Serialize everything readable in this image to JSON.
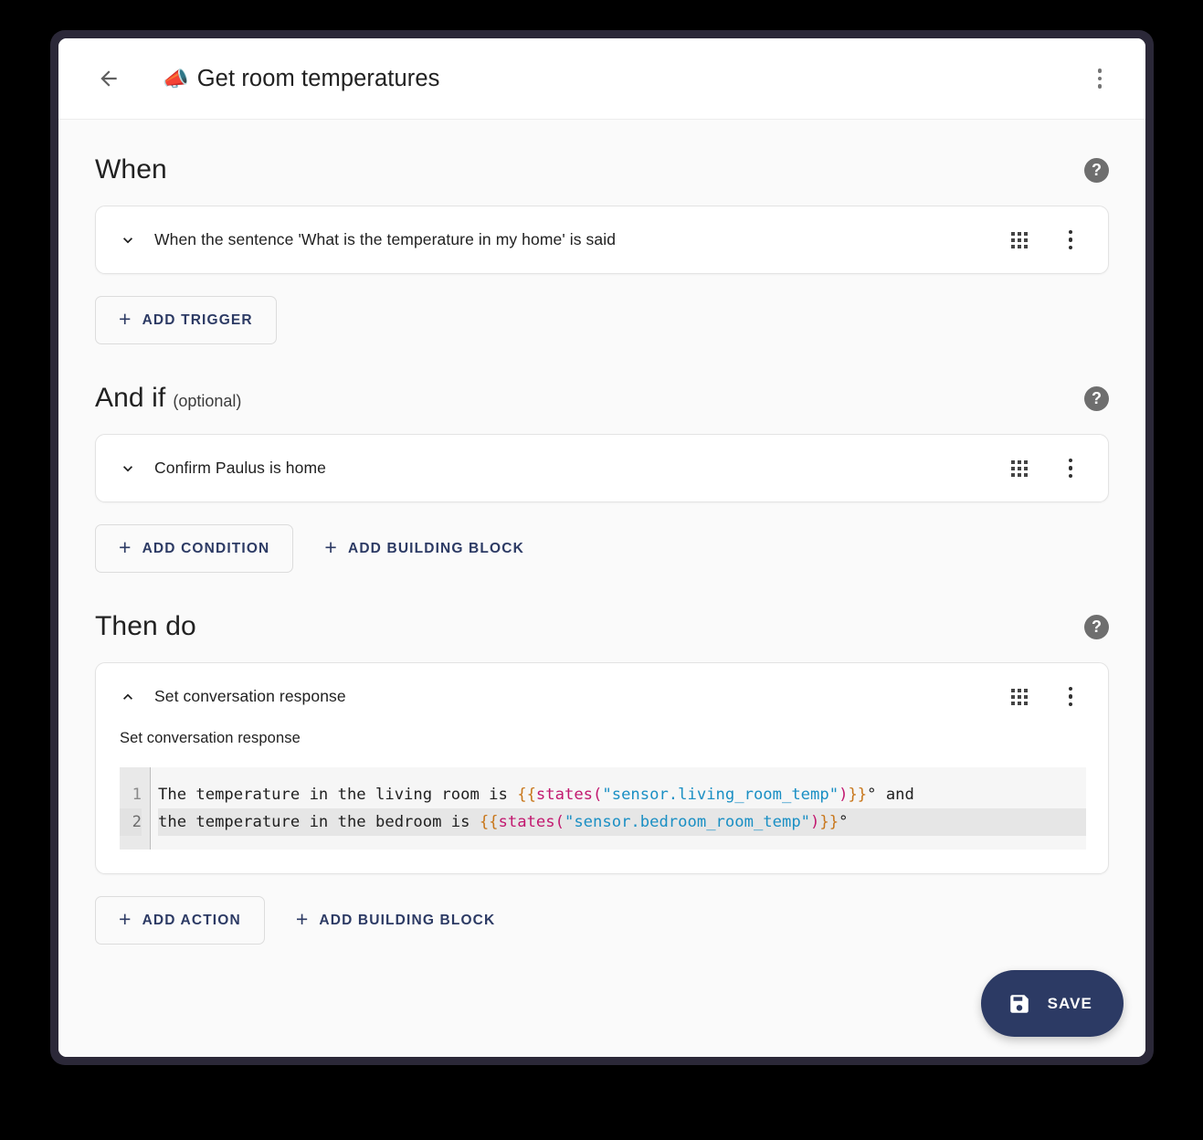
{
  "toolbar": {
    "back_icon": "arrow-left-icon",
    "emoji": "📣",
    "title": "Get room temperatures",
    "overflow_icon": "more-vertical-icon"
  },
  "sections": {
    "when": {
      "title": "When",
      "help_label": "?",
      "rows": [
        {
          "label": "When the sentence 'What is the temperature in my home' is said",
          "expanded": false
        }
      ],
      "buttons": [
        {
          "label": "ADD TRIGGER",
          "plus": "+",
          "style": "outlined"
        }
      ]
    },
    "and_if": {
      "title": "And if",
      "optional": "(optional)",
      "help_label": "?",
      "rows": [
        {
          "label": "Confirm Paulus is home",
          "expanded": false
        }
      ],
      "buttons": [
        {
          "label": "ADD CONDITION",
          "plus": "+",
          "style": "outlined"
        },
        {
          "label": "ADD BUILDING BLOCK",
          "plus": "+",
          "style": "text"
        }
      ]
    },
    "then_do": {
      "title": "Then do",
      "help_label": "?",
      "row": {
        "label": "Set conversation response",
        "expanded": true,
        "field_label": "Set conversation response",
        "editor": {
          "line_numbers": [
            "1",
            "2"
          ],
          "active_line": 2,
          "lines": [
            [
              {
                "t": "The temperature in the living room is ",
                "c": "plain"
              },
              {
                "t": "{{",
                "c": "brace"
              },
              {
                "t": "states",
                "c": "fn"
              },
              {
                "t": "(",
                "c": "paren"
              },
              {
                "t": "\"sensor.living_room_temp\"",
                "c": "str"
              },
              {
                "t": ")",
                "c": "paren"
              },
              {
                "t": "}}",
                "c": "brace"
              },
              {
                "t": "° and",
                "c": "plain"
              }
            ],
            [
              {
                "t": "the temperature in the bedroom is ",
                "c": "plain"
              },
              {
                "t": "{{",
                "c": "brace"
              },
              {
                "t": "states",
                "c": "fn"
              },
              {
                "t": "(",
                "c": "paren"
              },
              {
                "t": "\"sensor.bedroom_room_temp\"",
                "c": "str"
              },
              {
                "t": ")",
                "c": "paren"
              },
              {
                "t": "}}",
                "c": "brace"
              },
              {
                "t": "°",
                "c": "plain"
              }
            ]
          ]
        }
      },
      "buttons": [
        {
          "label": "ADD ACTION",
          "plus": "+",
          "style": "outlined"
        },
        {
          "label": "ADD BUILDING BLOCK",
          "plus": "+",
          "style": "text"
        }
      ]
    }
  },
  "save": {
    "label": "SAVE",
    "icon": "save-floppy-icon"
  },
  "colors": {
    "accent": "#2C3A64",
    "window_frame": "#2B2838",
    "page_background": "#000000",
    "surface": "#FAFAFA",
    "card": "#FFFFFF",
    "help_badge": "#6E6E6E",
    "code_brace": "#C8761A",
    "code_function": "#C2186F",
    "code_string": "#1A8FC4"
  }
}
